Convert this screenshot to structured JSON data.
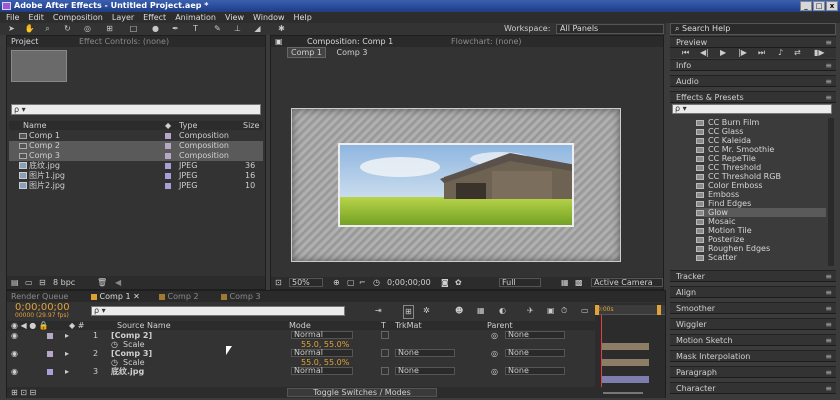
{
  "window": {
    "title": "Adobe After Effects - Untitled Project.aep *",
    "buttons": [
      "_",
      "□",
      "x"
    ]
  },
  "menu": [
    "File",
    "Edit",
    "Composition",
    "Layer",
    "Effect",
    "Animation",
    "View",
    "Window",
    "Help"
  ],
  "toolbar": {
    "workspace_label": "Workspace:",
    "workspace_value": "All Panels",
    "search_help": "Search Help"
  },
  "project": {
    "tab": "Project",
    "effect_controls_tab": "Effect Controls: (none)",
    "search_placeholder": "ρ ▾",
    "columns": {
      "name": "Name",
      "type": "Type",
      "size": "Size"
    },
    "items": [
      {
        "name": "Comp 1",
        "type": "Composition",
        "size": "",
        "kind": "comp",
        "color": "#b8a8c8"
      },
      {
        "name": "Comp 2",
        "type": "Composition",
        "size": "",
        "kind": "comp",
        "color": "#b8a8c8"
      },
      {
        "name": "Comp 3",
        "type": "Composition",
        "size": "",
        "kind": "comp",
        "color": "#b8a8c8"
      },
      {
        "name": "底纹.jpg",
        "type": "JPEG",
        "size": "36",
        "kind": "image",
        "color": "#a9a0d6"
      },
      {
        "name": "图片1.jpg",
        "type": "JPEG",
        "size": "16",
        "kind": "image",
        "color": "#a9a0d6"
      },
      {
        "name": "图片2.jpg",
        "type": "JPEG",
        "size": "10",
        "kind": "image",
        "color": "#a9a0d6"
      }
    ],
    "bpc": "8 bpc"
  },
  "composition": {
    "tab": "Composition: Comp 1",
    "flowchart_tab": "Flowchart: (none)",
    "breadcrumb": [
      "Comp 1",
      "Comp 3"
    ],
    "zoom": "50%",
    "timecode": "0;00;00;00",
    "resolution": "Full",
    "camera": "Active Camera"
  },
  "right_panels": {
    "preview": "Preview",
    "info": "Info",
    "audio": "Audio",
    "effects_presets": "Effects & Presets",
    "effects_search": "ρ ▾",
    "effects": [
      "CC Burn Film",
      "CC Glass",
      "CC Kaleida",
      "CC Mr. Smoothie",
      "CC RepeTile",
      "CC Threshold",
      "CC Threshold RGB",
      "Color Emboss",
      "Emboss",
      "Find Edges",
      "Glow",
      "Mosaic",
      "Motion Tile",
      "Posterize",
      "Roughen Edges",
      "Scatter"
    ],
    "selected_effect": "Glow",
    "bottom": [
      "Tracker",
      "Align",
      "Smoother",
      "Wiggler",
      "Motion Sketch",
      "Mask Interpolation",
      "Paragraph",
      "Character"
    ]
  },
  "timeline": {
    "render_queue_tab": "Render Queue",
    "tabs": [
      "Comp 1",
      "Comp 2",
      "Comp 3"
    ],
    "timecode": "0;00;00;00",
    "fps": "00000 (29.97 fps)",
    "search_placeholder": "ρ ▾",
    "columns": {
      "source_name": "Source Name",
      "mode": "Mode",
      "t": "T",
      "trkmat": "TrkMat",
      "parent": "Parent"
    },
    "layers": [
      {
        "num": "1",
        "name": "[Comp 2]",
        "mode": "Normal",
        "trkmat": "",
        "parent": "None",
        "scale_label": "Scale",
        "scale": "55.0, 55.0%"
      },
      {
        "num": "2",
        "name": "[Comp 3]",
        "mode": "Normal",
        "trkmat": "None",
        "parent": "None",
        "scale_label": "Scale",
        "scale": "55.0, 55.0%"
      },
      {
        "num": "3",
        "name": "底纹.jpg",
        "mode": "Normal",
        "trkmat": "None",
        "parent": "None"
      }
    ],
    "ruler_start": "0:00s",
    "toggle": "Toggle Switches / Modes"
  }
}
